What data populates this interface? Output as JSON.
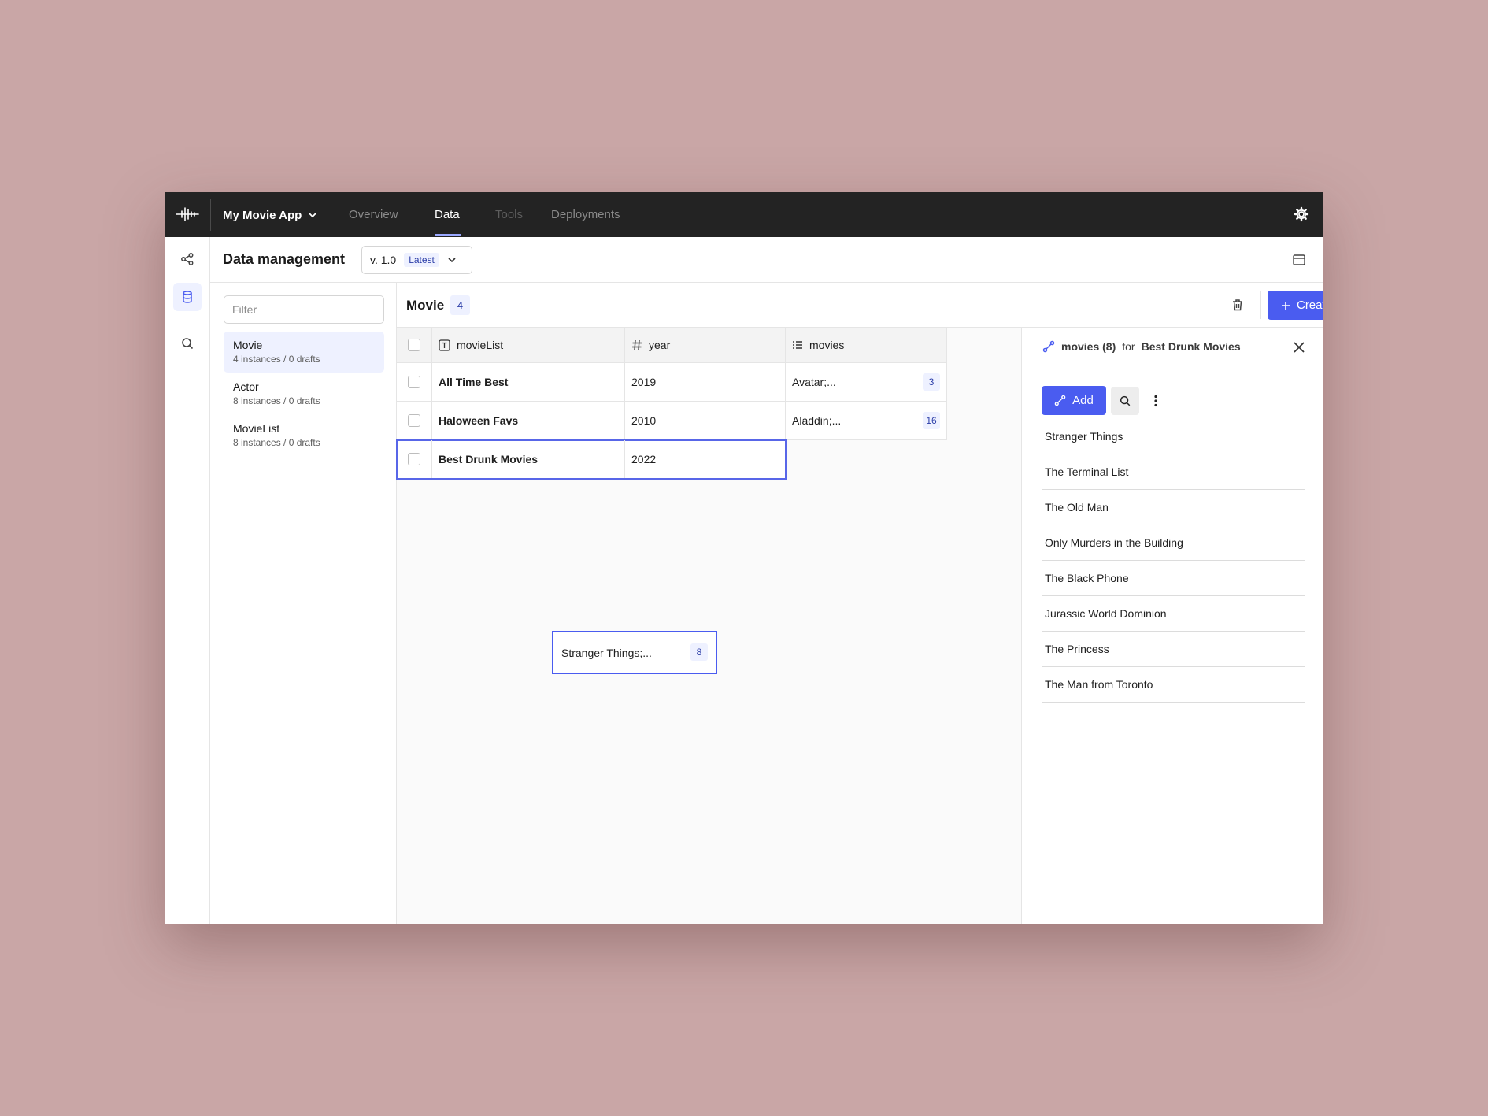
{
  "topbar": {
    "app_name": "My Movie App",
    "nav": [
      "Overview",
      "Data",
      "Tools",
      "Deployments"
    ],
    "active_tab": "Data"
  },
  "header": {
    "title": "Data management",
    "version": "v. 1.0",
    "version_badge": "Latest"
  },
  "models": {
    "filter_placeholder": "Filter",
    "items": [
      {
        "name": "Movie",
        "meta": "4 instances / 0 drafts",
        "active": true
      },
      {
        "name": "Actor",
        "meta": "8 instances / 0 drafts",
        "active": false
      },
      {
        "name": "MovieList",
        "meta": "8 instances / 0 drafts",
        "active": false
      }
    ]
  },
  "table": {
    "title": "Movie",
    "count": "4",
    "create_label": "Create",
    "columns": [
      {
        "label": "movieList",
        "icon": "text-type-icon"
      },
      {
        "label": "year",
        "icon": "hash-icon"
      },
      {
        "label": "movies",
        "icon": "list-icon"
      }
    ],
    "rows": [
      {
        "movieList": "All Time Best",
        "year": "2019",
        "movies": "Avatar;...",
        "movies_count": "3"
      },
      {
        "movieList": "Haloween Favs",
        "year": "2010",
        "movies": "Aladdin;...",
        "movies_count": "16"
      },
      {
        "movieList": "Best Drunk Movies",
        "year": "2022",
        "movies": "Stranger Things;...",
        "movies_count": "8"
      }
    ]
  },
  "detail": {
    "field": "movies (8)",
    "for_label": "for",
    "target": "Best Drunk Movies",
    "add_label": "Add",
    "items": [
      "Stranger Things",
      "The Terminal List",
      "The Old Man",
      "Only Murders in the Building",
      "The Black Phone",
      "Jurassic World Dominion",
      "The Princess",
      "The Man from Toronto"
    ]
  },
  "colors": {
    "accent": "#4a5cf0",
    "topbar": "#232323",
    "background": "#c9a6a6",
    "selection": "#eef1ff"
  }
}
